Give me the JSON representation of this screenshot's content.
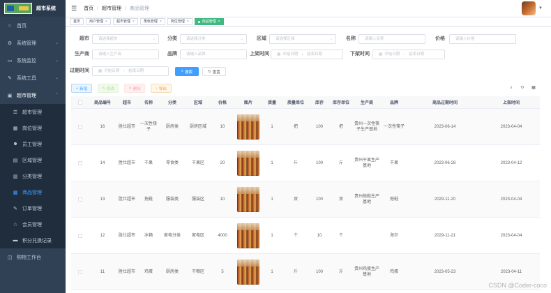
{
  "app": {
    "title": "超市系统"
  },
  "sidebar": {
    "items": [
      {
        "label": "首页",
        "icon": "home-icon",
        "glyph": "⌂",
        "arrow": ""
      },
      {
        "label": "系统管理",
        "icon": "gear-icon",
        "glyph": "⚙",
        "arrow": "⌄"
      },
      {
        "label": "系统监控",
        "icon": "monitor-icon",
        "glyph": "▭",
        "arrow": "⌄"
      },
      {
        "label": "系统工具",
        "icon": "tool-icon",
        "glyph": "✎",
        "arrow": "⌄"
      },
      {
        "label": "超市管理",
        "icon": "shop-icon",
        "glyph": "▣",
        "arrow": "⌃"
      }
    ],
    "subitems": [
      {
        "label": "超市管理",
        "icon": "list-icon",
        "glyph": "☰"
      },
      {
        "label": "岗位管理",
        "icon": "post-icon",
        "glyph": "▦"
      },
      {
        "label": "员工管理",
        "icon": "user-icon",
        "glyph": "☻"
      },
      {
        "label": "区域管理",
        "icon": "area-icon",
        "glyph": "▤"
      },
      {
        "label": "分类管理",
        "icon": "category-icon",
        "glyph": "▥"
      },
      {
        "label": "商品管理",
        "icon": "goods-icon",
        "glyph": "▩"
      },
      {
        "label": "订单管理",
        "icon": "order-icon",
        "glyph": "✎"
      },
      {
        "label": "会员管理",
        "icon": "star-icon",
        "glyph": "☆"
      },
      {
        "label": "积分兑换记录",
        "icon": "record-icon",
        "glyph": "▬"
      }
    ],
    "bottom": {
      "label": "购物工作台",
      "icon": "cart-icon",
      "glyph": "◫"
    }
  },
  "navbar": {
    "breadcrumb": [
      "首页",
      "超市管理",
      "商品管理"
    ]
  },
  "tags": [
    "首页",
    "用户管理",
    "超市管理",
    "角色管理",
    "岗位管理",
    "商品管理"
  ],
  "filters": {
    "row1": [
      {
        "label": "超市",
        "placeholder": "请选择超市"
      },
      {
        "label": "分类",
        "placeholder": "请选择分类"
      },
      {
        "label": "区域",
        "placeholder": "请选择区域"
      },
      {
        "label": "名称",
        "placeholder": "请输入名称"
      },
      {
        "label": "价格",
        "placeholder": "请输入价格"
      }
    ],
    "row2": [
      {
        "label": "生产商",
        "placeholder": "请输入生产商"
      },
      {
        "label": "品牌",
        "placeholder": "请输入品牌"
      },
      {
        "label": "上架时间",
        "start": "开始日期",
        "end": "结束日期"
      },
      {
        "label": "下架时间",
        "start": "开始日期",
        "end": "结束日期"
      }
    ],
    "row3": {
      "label": "过期时间",
      "start": "开始日期",
      "end": "结束日期"
    },
    "dash": "-",
    "search_label": "搜索",
    "reset_label": "重置"
  },
  "actions": {
    "add": "新增",
    "edit": "修改",
    "delete": "删除",
    "export": "导出"
  },
  "table": {
    "headers": [
      "",
      "商品编号",
      "超市",
      "名称",
      "分类",
      "区域",
      "价格",
      "图片",
      "质量",
      "质量单位",
      "库存",
      "库存单位",
      "生产商",
      "品牌",
      "商品过期时间",
      "上架时间"
    ],
    "rows": [
      {
        "id": "16",
        "shop": "胜仕超市",
        "name": "一次性筷子",
        "category": "厨房类",
        "area": "厨房区域",
        "price": "10",
        "qty": "1",
        "qunit": "把",
        "stock": "100",
        "sunit": "把",
        "maker": "贵州一次性筷子生产基地",
        "brand": "一次性筷子",
        "expire": "2023-06-14",
        "shelf": "2023-04-04"
      },
      {
        "id": "14",
        "shop": "胜仕超市",
        "name": "干果",
        "category": "零食类",
        "area": "干果区",
        "price": "20",
        "qty": "1",
        "qunit": "斤",
        "stock": "100",
        "sunit": "斤",
        "maker": "贵州干果生产基地",
        "brand": "干果",
        "expire": "2023-06-28",
        "shelf": "2023-04-12"
      },
      {
        "id": "13",
        "shop": "胜仕超市",
        "name": "拖鞋",
        "category": "服装类",
        "area": "服装区",
        "price": "10",
        "qty": "1",
        "qunit": "双",
        "stock": "100",
        "sunit": "双",
        "maker": "贵州拖鞋生产基地",
        "brand": "拖鞋",
        "expire": "2029-11-20",
        "shelf": "2023-04-04"
      },
      {
        "id": "12",
        "shop": "胜仕超市",
        "name": "冰箱",
        "category": "家电分类",
        "area": "家电区",
        "price": "4000",
        "qty": "1",
        "qunit": "个",
        "stock": "10",
        "sunit": "个",
        "maker": "",
        "brand": "海尔",
        "expire": "2029-11-21",
        "shelf": "2023-04-04"
      },
      {
        "id": "11",
        "shop": "胜仕超市",
        "name": "鸡蛋",
        "category": "厨房类",
        "area": "干粮区",
        "price": "5",
        "qty": "1",
        "qunit": "斤",
        "stock": "100",
        "sunit": "斤",
        "maker": "贵州鸡蛋生产基地",
        "brand": "鸡蛋",
        "expire": "2023-05-23",
        "shelf": "2023-04-11"
      }
    ]
  },
  "watermark": "CSDN @Coder-coco"
}
